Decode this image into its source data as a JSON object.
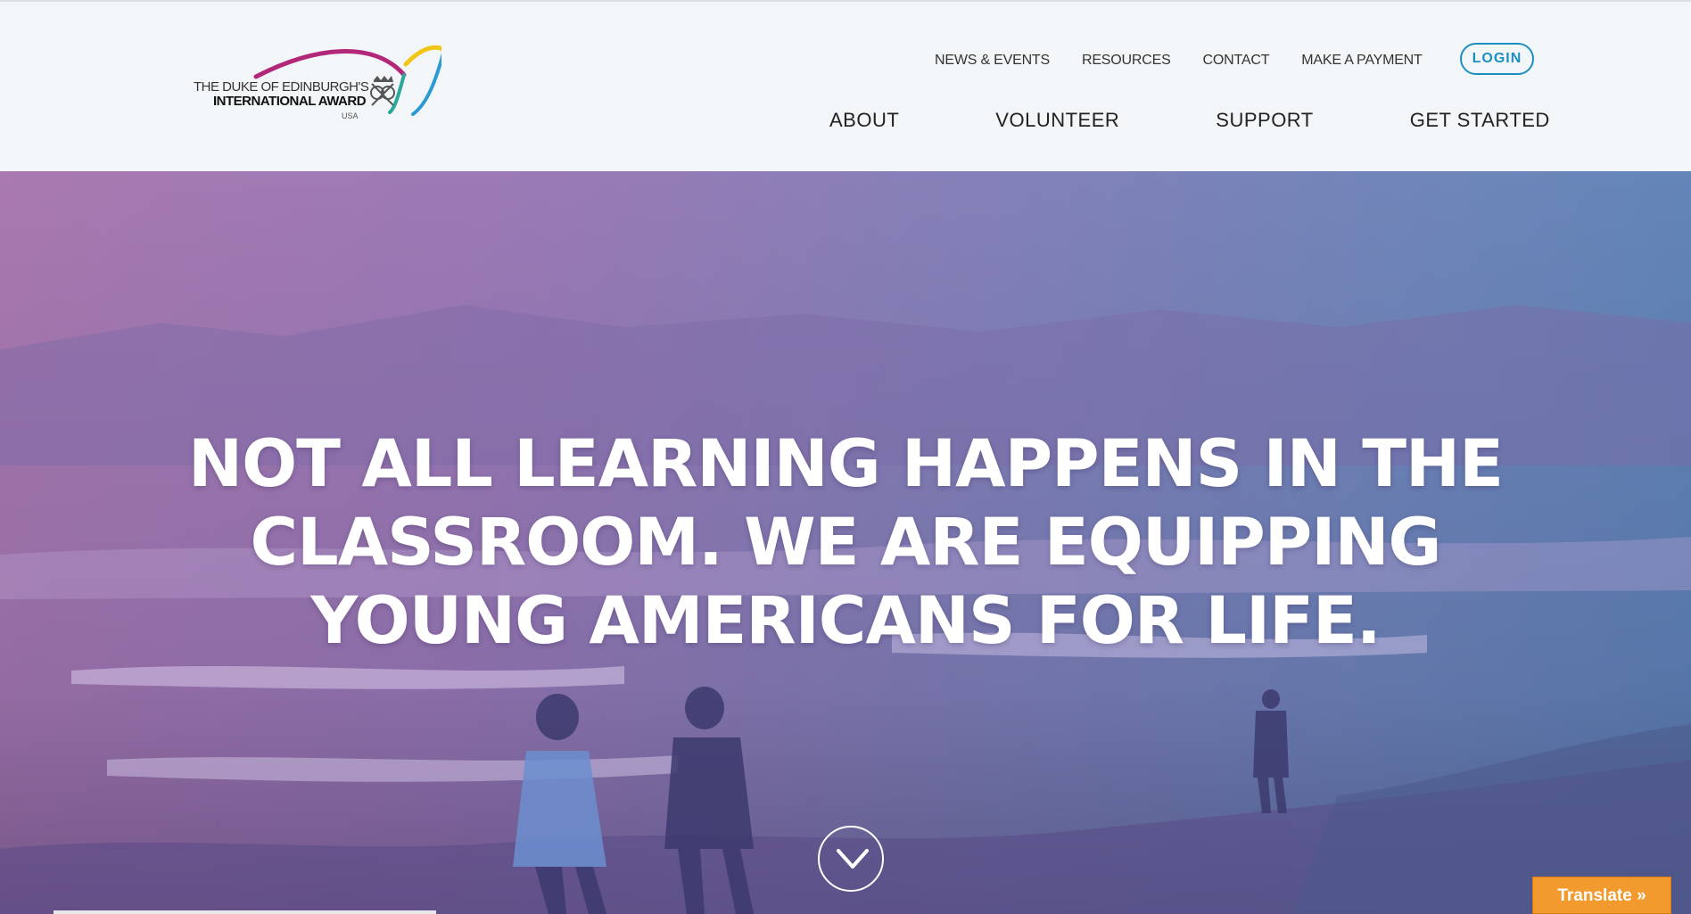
{
  "logo": {
    "line1": "THE DUKE OF EDINBURGH'S",
    "line2": "INTERNATIONAL AWARD",
    "line3": "USA"
  },
  "util_nav": {
    "news": "NEWS & EVENTS",
    "resources": "RESOURCES",
    "contact": "CONTACT",
    "payment": "MAKE A PAYMENT",
    "login": "LOGIN"
  },
  "main_nav": {
    "about": "ABOUT",
    "volunteer": "VOLUNTEER",
    "support": "SUPPORT",
    "get_started": "GET STARTED"
  },
  "hero": {
    "headline": "NOT ALL LEARNING HAPPENS IN THE CLASSROOM. WE ARE EQUIPPING YOUNG AMERICANS FOR LIFE.",
    "scroll_icon": "chevron-down-icon"
  },
  "translate": {
    "label": "Translate »"
  },
  "colors": {
    "accent": "#1c8fc2",
    "translate": "#f29a2e",
    "hero_left": "#a979b0",
    "hero_right": "#5d84b7"
  }
}
